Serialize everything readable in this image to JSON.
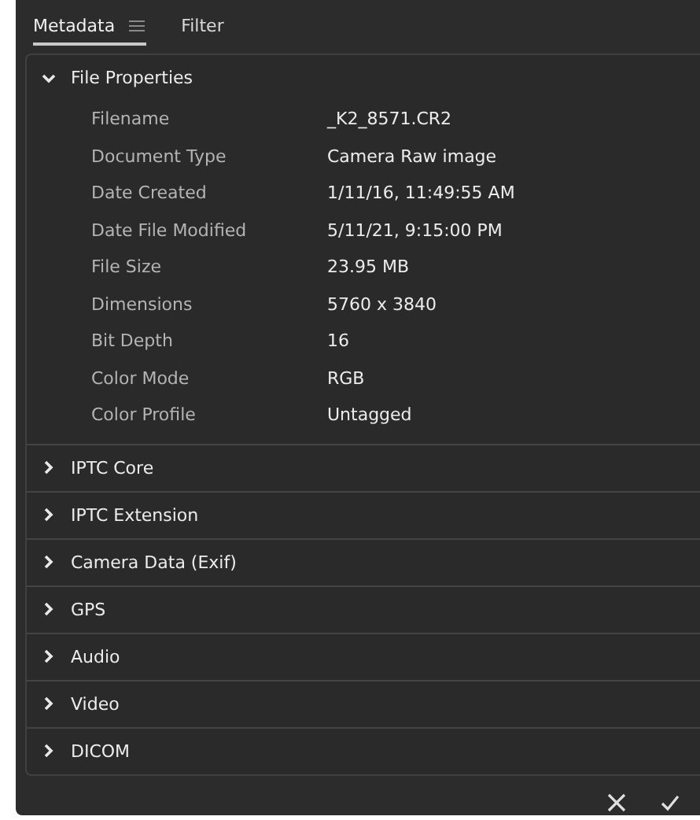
{
  "tabs": [
    {
      "label": "Metadata",
      "selected": true
    },
    {
      "label": "Filter",
      "selected": false
    }
  ],
  "sections": [
    {
      "title": "File Properties",
      "expanded": true,
      "fields": [
        {
          "label": "Filename",
          "value": "_K2_8571.CR2"
        },
        {
          "label": "Document Type",
          "value": "Camera Raw image"
        },
        {
          "label": "Date Created",
          "value": "1/11/16, 11:49:55 AM"
        },
        {
          "label": "Date File Modified",
          "value": "5/11/21, 9:15:00 PM"
        },
        {
          "label": "File Size",
          "value": "23.95 MB"
        },
        {
          "label": "Dimensions",
          "value": "5760 x 3840"
        },
        {
          "label": "Bit Depth",
          "value": "16"
        },
        {
          "label": "Color Mode",
          "value": "RGB"
        },
        {
          "label": "Color Profile",
          "value": "Untagged"
        }
      ]
    },
    {
      "title": "IPTC Core",
      "expanded": false
    },
    {
      "title": "IPTC Extension",
      "expanded": false
    },
    {
      "title": "Camera Data (Exif)",
      "expanded": false
    },
    {
      "title": "GPS",
      "expanded": false
    },
    {
      "title": "Audio",
      "expanded": false
    },
    {
      "title": "Video",
      "expanded": false
    },
    {
      "title": "DICOM",
      "expanded": false
    }
  ]
}
